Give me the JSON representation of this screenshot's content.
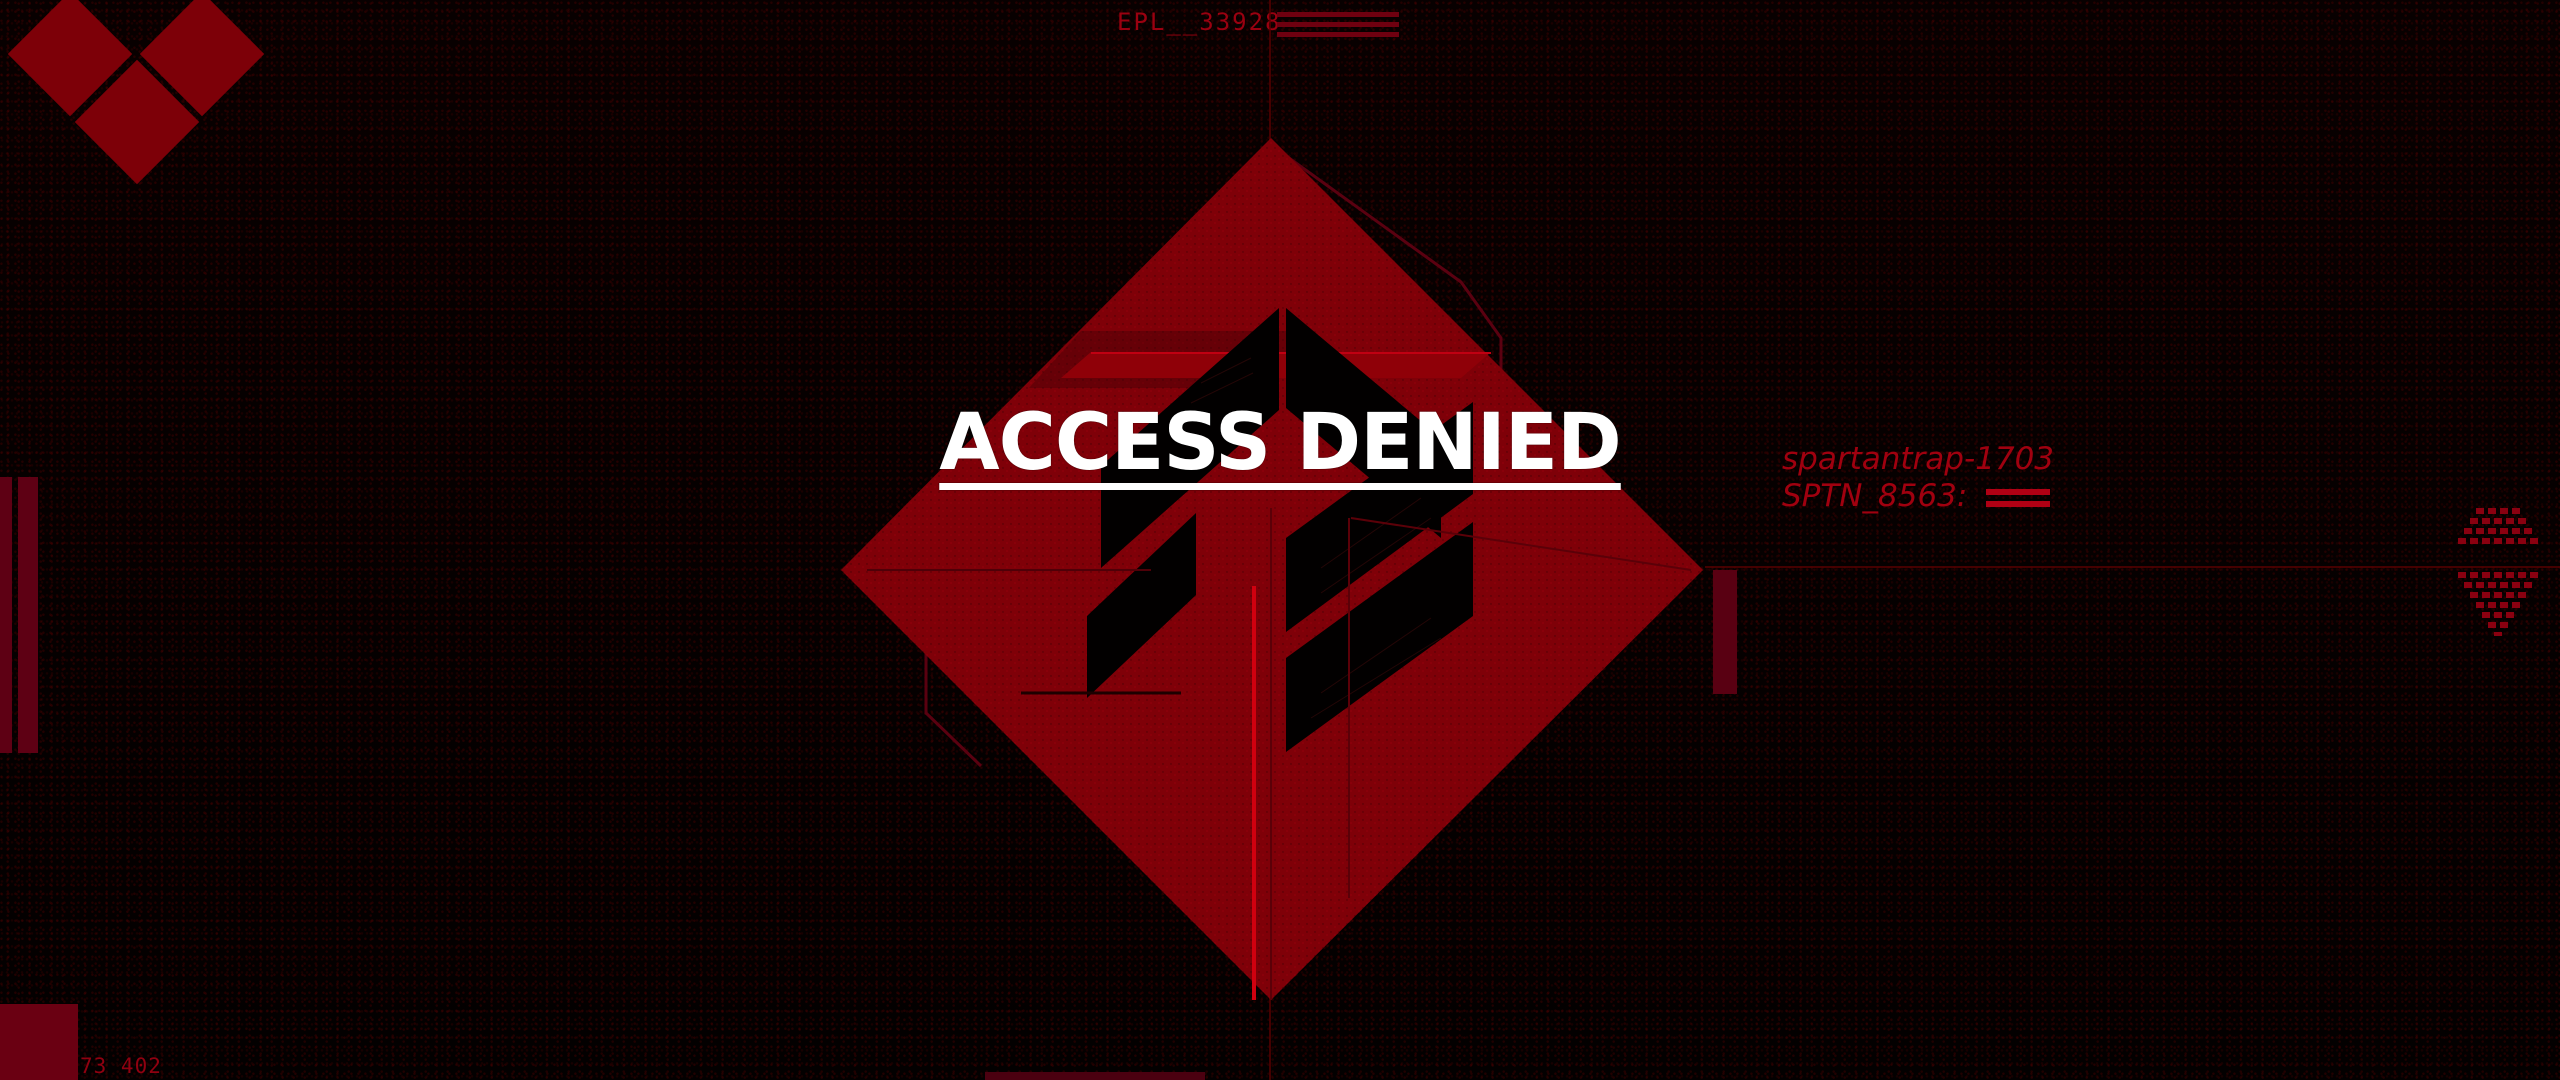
{
  "window": {
    "heading": "ACCESS DENIED"
  },
  "system": {
    "top_code": "EPL__33928",
    "trap_label": "spartantrap-1703",
    "trap_code": "SPTN_8563:",
    "bottom_code": "73 402"
  },
  "colors": {
    "accent_red": "#7d0008",
    "text_red": "#a0000f",
    "heading_white": "#ffffff"
  },
  "icons": {
    "emblem": "spartan-lambda-emblem-icon",
    "corner_logo": "diamond-cluster-icon",
    "right_ornament": "hex-dot-grid-icon"
  }
}
